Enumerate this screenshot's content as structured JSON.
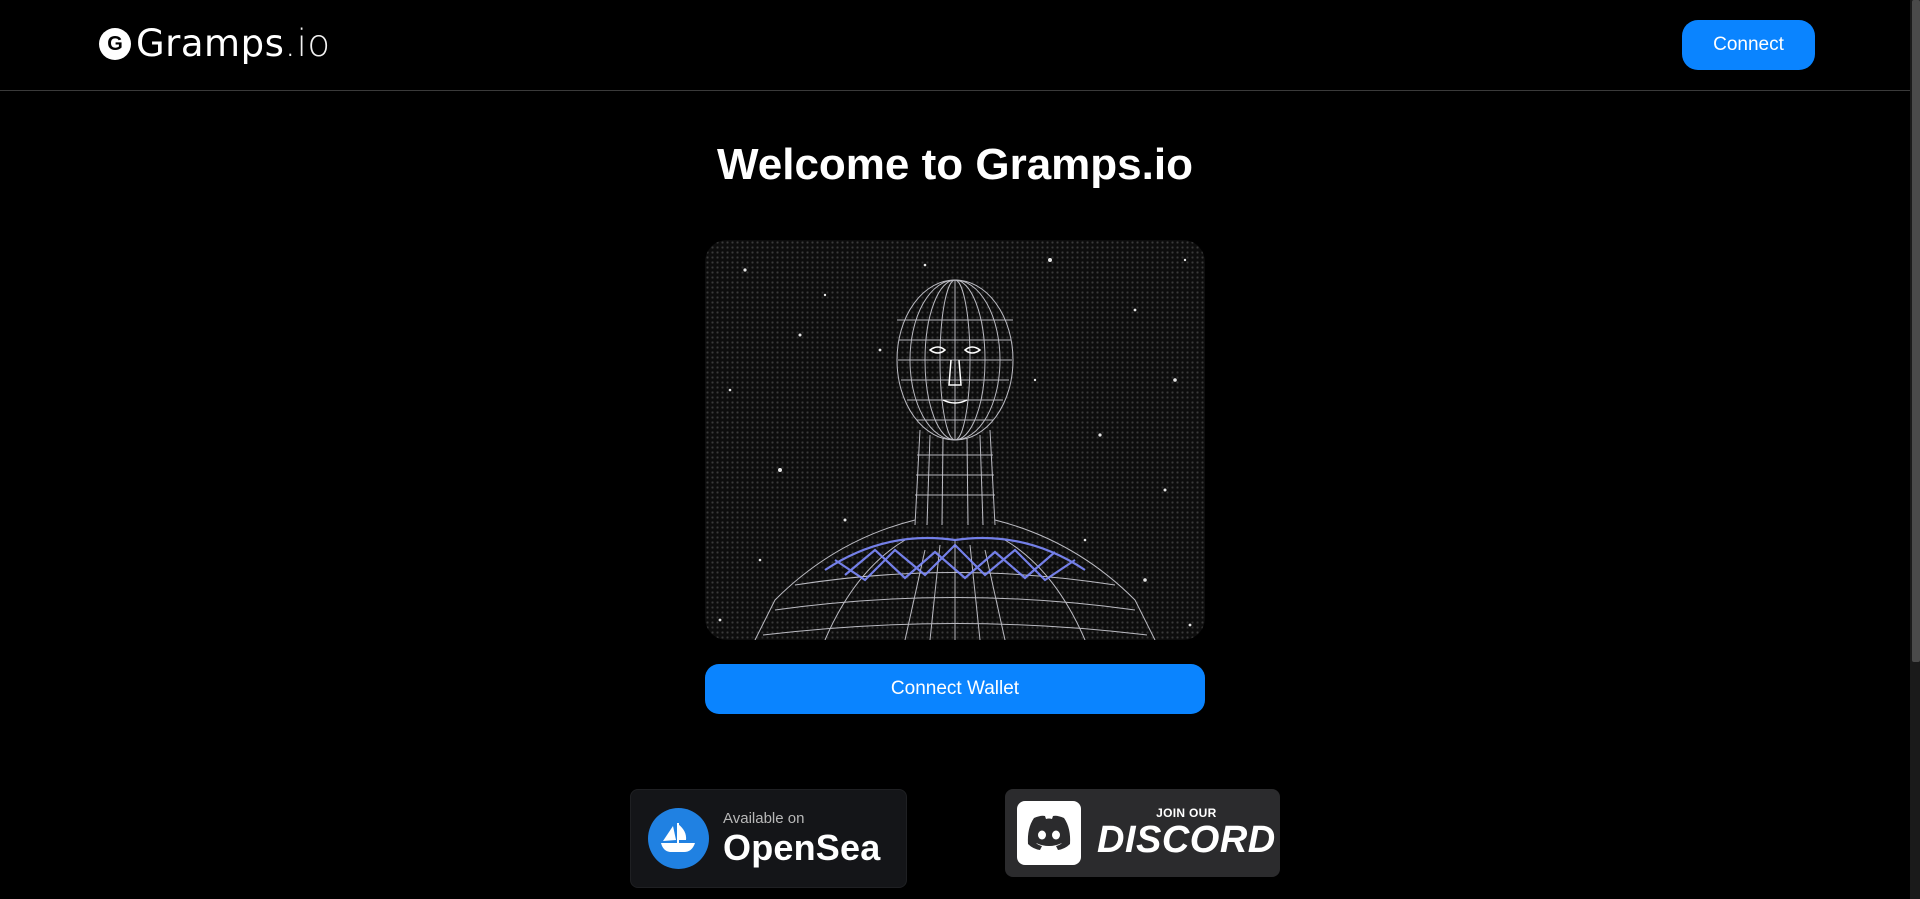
{
  "header": {
    "logo_letter": "G",
    "logo_text_main": "Gramps",
    "logo_text_suffix": ".io",
    "connect_label": "Connect"
  },
  "main": {
    "title": "Welcome to Gramps.io",
    "hero_image_icon": "wireframe-head-image",
    "connect_wallet_label": "Connect Wallet"
  },
  "badges": {
    "opensea": {
      "small": "Available on",
      "big": "OpenSea",
      "icon": "opensea-ship-icon"
    },
    "discord": {
      "small": "JOIN OUR",
      "big": "DISCORD",
      "icon": "discord-icon"
    }
  },
  "colors": {
    "accent": "#0a84ff",
    "background": "#000000",
    "opensea_blue": "#2081e2"
  }
}
